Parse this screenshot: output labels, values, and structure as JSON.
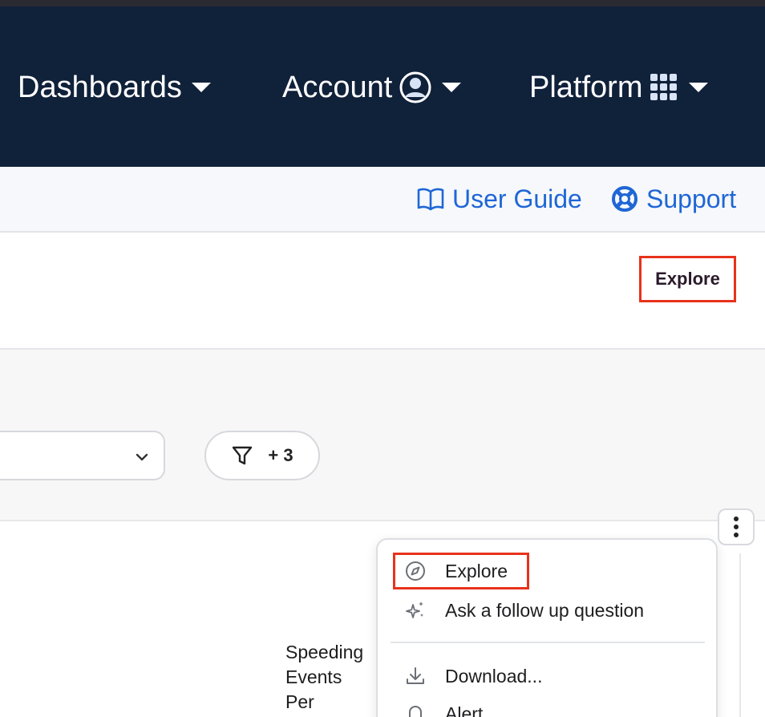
{
  "nav": {
    "items": [
      {
        "label": "Dashboards",
        "icon": "caret-down-icon"
      },
      {
        "label": "Account",
        "icon": "user-circle-icon"
      },
      {
        "label": "Platform",
        "icon": "grid-icon"
      }
    ]
  },
  "subbar": {
    "user_guide": "User Guide",
    "support": "Support"
  },
  "header": {
    "explore_label": "Explore"
  },
  "filters": {
    "filter_count": "+ 3"
  },
  "chart": {
    "label_lines": [
      "Speeding",
      "Events",
      "Per"
    ]
  },
  "menu": {
    "items": [
      {
        "label": "Explore",
        "icon": "compass-icon"
      },
      {
        "label": "Ask a follow up question",
        "icon": "sparkle-icon"
      },
      {
        "label": "Download...",
        "icon": "download-icon"
      },
      {
        "label": "Alert",
        "icon": "bell-icon"
      }
    ]
  },
  "colors": {
    "nav_bg": "#10213a",
    "link_blue": "#1f66d6",
    "highlight_red": "#e8321b"
  }
}
